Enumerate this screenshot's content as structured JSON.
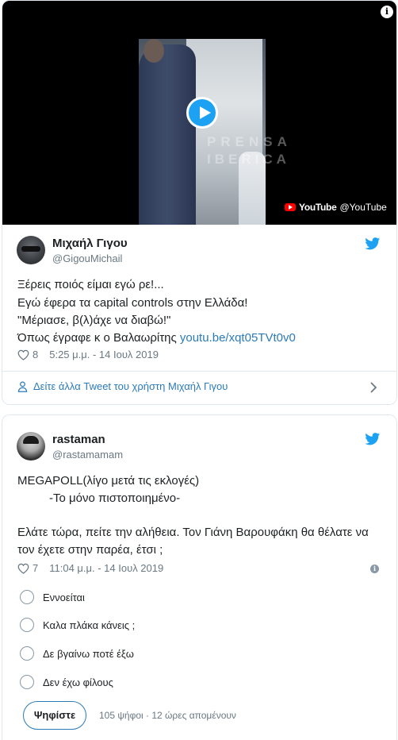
{
  "tweet1": {
    "video": {
      "watermark_line1": "PRENSA",
      "watermark_line2": "IBERICA",
      "badge_word": "YouTube",
      "badge_handle": "@YouTube"
    },
    "author_name": "Μιχαήλ Γιγου",
    "author_handle": "@GigouMichail",
    "lines": [
      "Ξέρεις ποιός είμαι εγώ ρε!...",
      "Εγώ έφερα τα capital controls στην Ελλάδα!",
      "\"Μέριασε, β(λ)άχε να διαβώ!\"",
      "Όπως έγραφε κ ο Βαλαωρίτης "
    ],
    "link_text": "youtu.be/xqt05TVt0v0",
    "likes": "8",
    "timestamp": "5:25 μ.μ. - 14 Ιουλ 2019",
    "more_link": "Δείτε άλλα Tweet του χρήστη Μιχαήλ Γιγου"
  },
  "tweet2": {
    "author_name": "rastaman",
    "author_handle": "@rastamamam",
    "lines": [
      "MEGAPOLL(λίγο μετά τις εκλογές)",
      "-Το μόνο πιστοποιημένο-",
      "Ελάτε τώρα, πείτε την αλήθεια. Τον Γιάνη Βαρουφάκη θα θέλατε να",
      "τον έχετε στην παρέα, έτσι ;"
    ],
    "likes": "7",
    "timestamp": "11:04 μ.μ. - 14 Ιουλ 2019",
    "poll": {
      "options": [
        "Εννοείται",
        "Καλα πλάκα κάνεις ;",
        "Δε βγαίνω ποτέ έξω",
        "Δεν έχω φίλους"
      ],
      "vote_label": "Ψηφίστε",
      "votes_text": "105 ψήφοι · 12 ώρες απομένουν"
    }
  },
  "colors": {
    "accent": "#1da1f2",
    "link": "#2b7bb9",
    "muted": "#697882",
    "border": "#e1e8ed"
  }
}
